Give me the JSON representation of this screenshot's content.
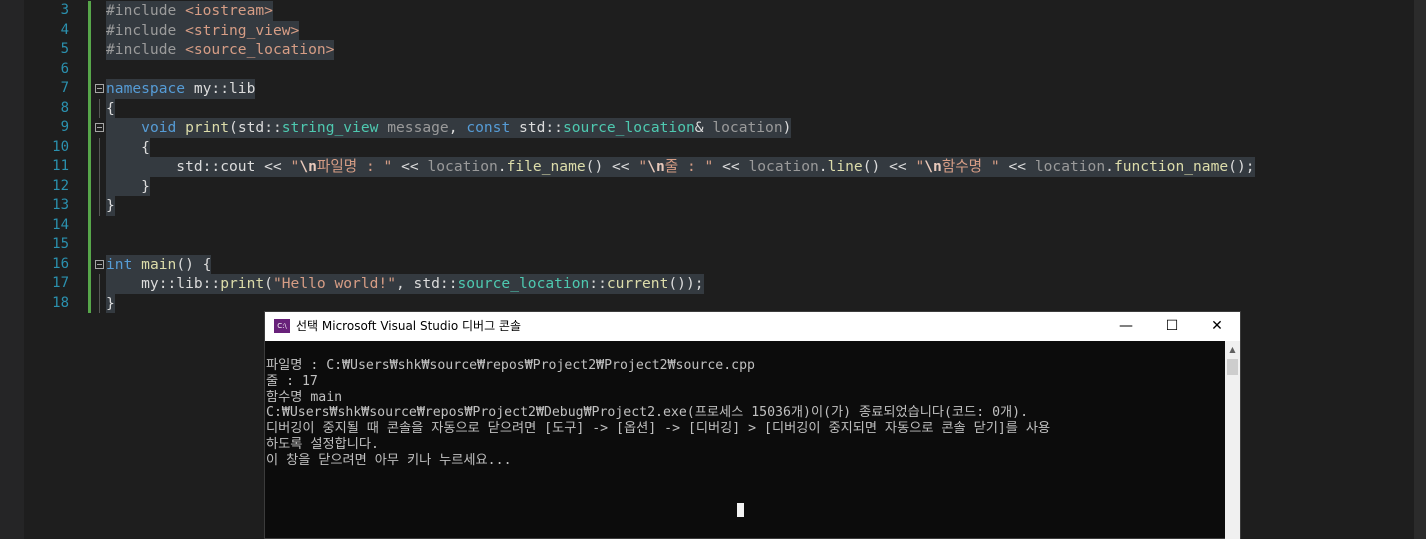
{
  "editor": {
    "lines": [
      {
        "num": "3",
        "parts": [
          [
            "pp",
            "#include "
          ],
          [
            "st",
            "<iostream>"
          ]
        ]
      },
      {
        "num": "4",
        "parts": [
          [
            "pp",
            "#include "
          ],
          [
            "st",
            "<string_view>"
          ]
        ]
      },
      {
        "num": "5",
        "parts": [
          [
            "pp",
            "#include "
          ],
          [
            "st",
            "<source_location>"
          ]
        ]
      },
      {
        "num": "6",
        "parts": []
      },
      {
        "num": "7",
        "parts": [
          [
            "kw",
            "namespace"
          ],
          [
            "ns",
            " my::lib"
          ]
        ]
      },
      {
        "num": "8",
        "parts": [
          [
            "ns",
            "{"
          ]
        ]
      },
      {
        "num": "9",
        "parts": [
          [
            "ns",
            "    "
          ],
          [
            "kw",
            "void"
          ],
          [
            "ns",
            " "
          ],
          [
            "fn",
            "print"
          ],
          [
            "ns",
            "(std::"
          ],
          [
            "ty",
            "string_view"
          ],
          [
            "ns",
            " "
          ],
          [
            "pa",
            "message"
          ],
          [
            "ns",
            ", "
          ],
          [
            "kw",
            "const"
          ],
          [
            "ns",
            " std::"
          ],
          [
            "ty",
            "source_location"
          ],
          [
            "ns",
            "& "
          ],
          [
            "pa",
            "location"
          ],
          [
            "ns",
            ")"
          ]
        ]
      },
      {
        "num": "10",
        "parts": [
          [
            "ns",
            "    {"
          ]
        ]
      },
      {
        "num": "11",
        "parts": [
          [
            "ns",
            "        std::cout << "
          ],
          [
            "st",
            "\""
          ],
          [
            "esc",
            "\\n"
          ],
          [
            "st",
            "파일명 : \""
          ],
          [
            "ns",
            " << "
          ],
          [
            "pa",
            "location"
          ],
          [
            "ns",
            "."
          ],
          [
            "fn",
            "file_name"
          ],
          [
            "ns",
            "() << "
          ],
          [
            "st",
            "\""
          ],
          [
            "esc",
            "\\n"
          ],
          [
            "st",
            "줄 : \""
          ],
          [
            "ns",
            " << "
          ],
          [
            "pa",
            "location"
          ],
          [
            "ns",
            "."
          ],
          [
            "fn",
            "line"
          ],
          [
            "ns",
            "() << "
          ],
          [
            "st",
            "\""
          ],
          [
            "esc",
            "\\n"
          ],
          [
            "st",
            "함수명 \""
          ],
          [
            "ns",
            " << "
          ],
          [
            "pa",
            "location"
          ],
          [
            "ns",
            "."
          ],
          [
            "fn",
            "function_name"
          ],
          [
            "ns",
            "();"
          ]
        ]
      },
      {
        "num": "12",
        "parts": [
          [
            "ns",
            "    }"
          ]
        ]
      },
      {
        "num": "13",
        "parts": [
          [
            "ns",
            "}"
          ]
        ]
      },
      {
        "num": "14",
        "parts": []
      },
      {
        "num": "15",
        "parts": []
      },
      {
        "num": "16",
        "parts": [
          [
            "kw",
            "int"
          ],
          [
            "ns",
            " "
          ],
          [
            "fn",
            "main"
          ],
          [
            "ns",
            "() {"
          ]
        ]
      },
      {
        "num": "17",
        "parts": [
          [
            "ns",
            "    my::lib::"
          ],
          [
            "fn",
            "print"
          ],
          [
            "ns",
            "("
          ],
          [
            "st",
            "\"Hello world!\""
          ],
          [
            "ns",
            ", std::"
          ],
          [
            "ty",
            "source_location"
          ],
          [
            "ns",
            "::"
          ],
          [
            "fn",
            "current"
          ],
          [
            "ns",
            "());"
          ]
        ]
      },
      {
        "num": "18",
        "parts": [
          [
            "ns",
            "}"
          ]
        ]
      }
    ]
  },
  "console": {
    "title": "선택 Microsoft Visual Studio 디버그 콘솔",
    "icon_text": "C:\\",
    "minimize": "—",
    "maximize": "☐",
    "close": "✕",
    "lines": [
      "파일명 : C:₩Users₩shk₩source₩repos₩Project2₩Project2₩source.cpp",
      "줄 : 17",
      "함수명 main",
      "C:₩Users₩shk₩source₩repos₩Project2₩Debug₩Project2.exe(프로세스 15036개)이(가) 종료되었습니다(코드: 0개).",
      "디버깅이 중지될 때 콘솔을 자동으로 닫으려면 [도구] -> [옵션] -> [디버깅] > [디버깅이 중지되면 자동으로 콘솔 닫기]를 사용",
      "하도록 설정합니다.",
      "이 창을 닫으려면 아무 키나 누르세요..."
    ]
  }
}
